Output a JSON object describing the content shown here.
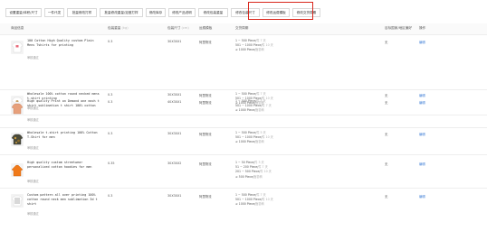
{
  "toolbar": {
    "buttons": [
      "设置重量/体积/尺寸",
      "一件代发",
      "批量修改打样",
      "批量修改重量/定做打样",
      "修改库存",
      "修改产品说明",
      "修改包装重量",
      "修改包装尺寸",
      "修改运费模板",
      "修改交货周期"
    ]
  },
  "table": {
    "headers": {
      "product": "商品信息",
      "weight": "包装重量",
      "weight_unit": "(kg)",
      "size": "包装尺寸",
      "size_unit": "(cm)",
      "shipping": "运费模板",
      "lead_time": "交货周期",
      "origin": "目标国家/地区偏好",
      "action": "操作"
    },
    "rows": [
      {
        "title": "100 Cotton High Quality custom Plain Mens Tshirts for printing",
        "status": "审核通过",
        "weight": "0.3",
        "size": "30X30X1",
        "shipping": "阿里物流",
        "lead": [
          {
            "range": "1 ~ 500 Piece/",
            "unit": "件 7 天"
          },
          {
            "range": "501 ~ 1000 Piece/",
            "unit": "件 10 天"
          },
          {
            "range": "≥ 1000 Piece/",
            "unit": "面协商"
          }
        ],
        "origin": "无",
        "action": "编辑"
      },
      {
        "title": "Wholesale 100% cotton round necked mens t-shirt printing",
        "status": "审核通过",
        "weight": "0.3",
        "size": "30X30X1",
        "shipping": "阿里物流",
        "lead": [
          {
            "range": "1 ~ 500 Piece/",
            "unit": "件 7 天"
          },
          {
            "range": "501 ~ 1000 Piece/",
            "unit": "件 10 天"
          },
          {
            "range": "≥ 1000 Piece/",
            "unit": "面协商"
          }
        ],
        "origin": "无",
        "action": "编辑"
      },
      {
        "title": "High quality Print on Demand one each t shirt sublimation t shirt 100% cotton",
        "status": "审核通过",
        "weight": "0.3",
        "size": "40X30X1",
        "shipping": "阿里物流",
        "lead": [
          {
            "range": "1 ~ 500 Piece/",
            "unit": "件 5 天"
          },
          {
            "range": "501 ~ 1000 Piece/",
            "unit": "件 7 天"
          },
          {
            "range": "≥ 1000 Piece/",
            "unit": "面协商"
          }
        ],
        "origin": "无",
        "action": "编辑"
      },
      {
        "title": "Wholesale t-shirt printing 100% Cotton T-Shirt for men",
        "status": "审核通过",
        "weight": "0.3",
        "size": "30X30X1",
        "shipping": "阿里物流",
        "lead": [
          {
            "range": "1 ~ 500 Piece/",
            "unit": "件 5 天"
          },
          {
            "range": "501 ~ 1000 Piece/",
            "unit": "件 10 天"
          },
          {
            "range": "≥ 1000 Piece/",
            "unit": "面协商"
          }
        ],
        "origin": "无",
        "action": "编辑"
      },
      {
        "title": "High quality custom streetwear personalized cotton hoodies for men",
        "status": "审核通过",
        "weight": "0.35",
        "size": "30X30X2",
        "shipping": "阿里物流",
        "lead": [
          {
            "range": "1 ~ 50 Piece/",
            "unit": "件 3 天"
          },
          {
            "range": "51 ~ 200 Piece/",
            "unit": "件 7 天"
          },
          {
            "range": "201 ~ 500 Piece/",
            "unit": "件 10 天"
          },
          {
            "range": "≥ 500 Piece/",
            "unit": "面协商"
          }
        ],
        "origin": "无",
        "action": "编辑"
      },
      {
        "title": "Custom pattern all over printing 100% cotton round neck men sublimation 3d t shirt",
        "status": "审核通过",
        "weight": "0.3",
        "size": "30X30X1",
        "shipping": "阿里物流",
        "lead": [
          {
            "range": "1 ~ 500 Piece/",
            "unit": "件 7 天"
          },
          {
            "range": "501 ~ 1000 Piece/",
            "unit": "件 10 天"
          },
          {
            "range": "≥ 1000 Piece/",
            "unit": "面协商"
          }
        ],
        "origin": "无",
        "action": "编辑"
      }
    ]
  },
  "colors": {
    "highlight": "#d9261c",
    "link": "#3a7bd5"
  },
  "thumb_icons": [
    "white-tshirt-icon",
    "white-tshirt-icon",
    "peach-tshirt-icon",
    "camo-tshirt-icon",
    "orange-hoodie-icon",
    "white-print-tshirt-icon"
  ]
}
